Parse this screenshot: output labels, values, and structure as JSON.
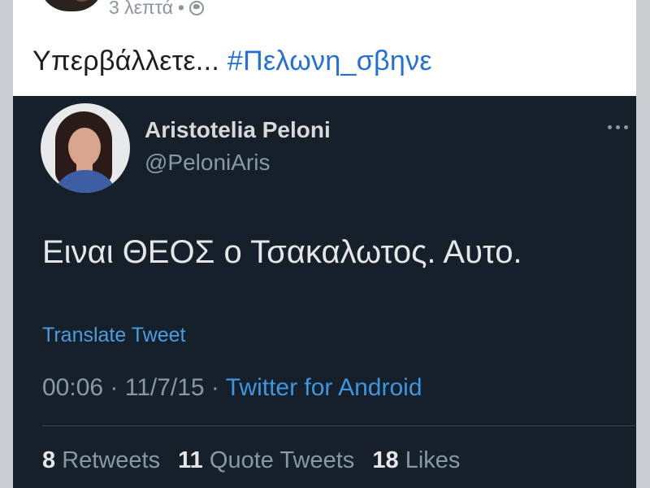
{
  "facebook_post": {
    "time": "3 λεπτά",
    "separator": "•",
    "text": "Υπερβάλλετε...",
    "hashtag": "#Πελωνη_σβηνε"
  },
  "tweet": {
    "author_name": "Aristotelia Peloni",
    "author_handle": "@PeloniAris",
    "body": "Ειναι ΘΕΟΣ ο Τσακαλωτος. Αυτο.",
    "translate_label": "Translate Tweet",
    "time": "00:06 · 11/7/15 ·",
    "source": "Twitter for Android",
    "stats": {
      "retweets_count": "8",
      "retweets_label": "Retweets",
      "quote_tweets_count": "11",
      "quote_tweets_label": "Quote Tweets",
      "likes_count": "18",
      "likes_label": "Likes"
    }
  },
  "icons": {
    "visibility": "globe-icon",
    "more": "more-icon"
  },
  "colors": {
    "hashtag": "#216fdb",
    "tweet_background": "#15202b",
    "link": "#3e95e0"
  }
}
